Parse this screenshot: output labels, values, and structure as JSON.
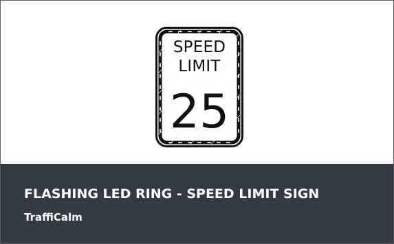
{
  "product": {
    "title": "FLASHING LED RING - SPEED LIMIT SIGN",
    "brand": "TraffiCalm"
  },
  "sign": {
    "line1": "SPEED",
    "line2": "LIMIT",
    "value": "25",
    "icon": "speed-limit-sign-icon"
  },
  "colors": {
    "footer_background": "#343a43",
    "footer_text": "#ffffff",
    "sign_black": "#111111",
    "sign_white": "#ffffff"
  }
}
